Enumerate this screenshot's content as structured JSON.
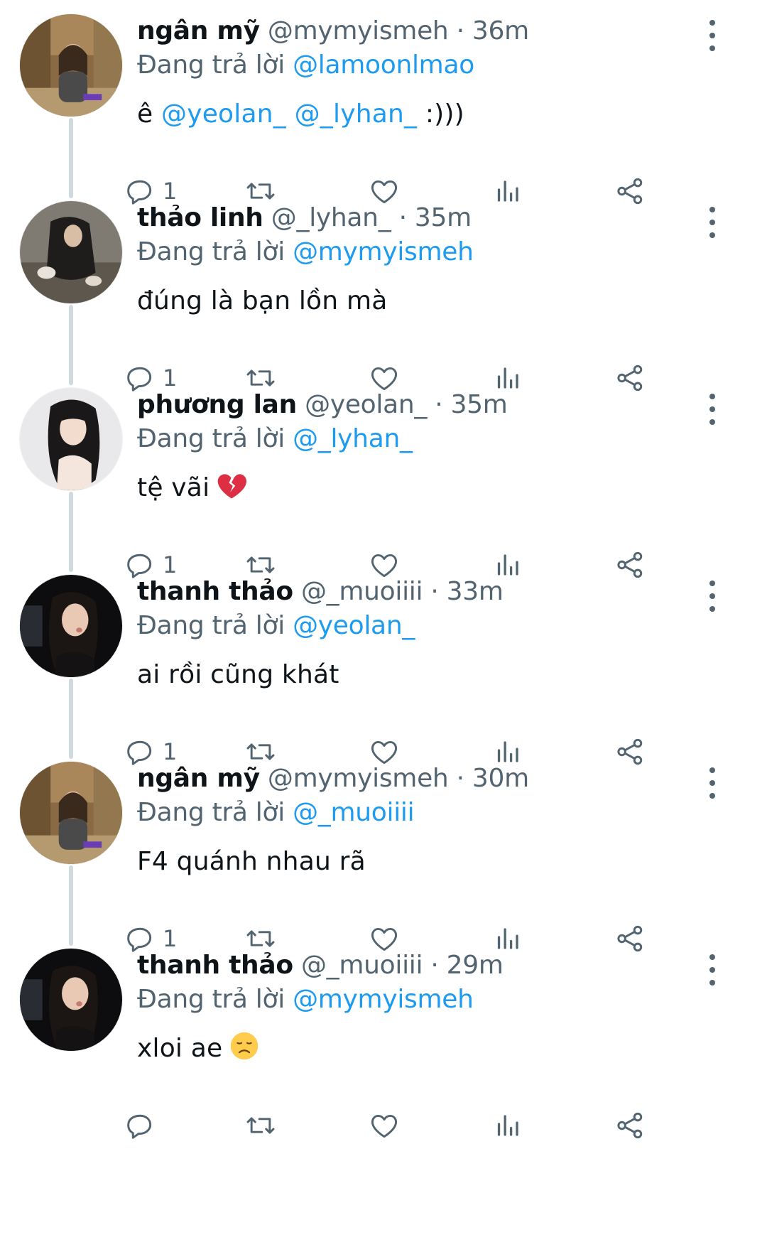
{
  "reply_prefix": "Đang trả lời",
  "separator": "·",
  "colors": {
    "accent": "#1d9bf0",
    "secondary_text": "#536471",
    "primary_text": "#0f1419",
    "thread_line": "#cfd9de"
  },
  "tweets": [
    {
      "display_name": "ngân mỹ",
      "handle": "@mymyismeh",
      "time": "36m",
      "reply_to": "@lamoonlmao",
      "text_parts": [
        "ê ",
        "@yeolan_ @_lyhan_",
        " :)))"
      ],
      "emoji": "",
      "reply_count": "1",
      "avatar": "avatar-mymyismeh"
    },
    {
      "display_name": "thảo linh",
      "handle": "@_lyhan_",
      "time": "35m",
      "reply_to": "@mymyismeh",
      "text_parts": [
        "đúng là bạn lồn mà",
        "",
        ""
      ],
      "emoji": "",
      "reply_count": "1",
      "avatar": "avatar-lyhan"
    },
    {
      "display_name": "phương lan",
      "handle": "@yeolan_",
      "time": "35m",
      "reply_to": "@_lyhan_",
      "text_parts": [
        "tệ vãi",
        "",
        ""
      ],
      "emoji": "broken-heart",
      "reply_count": "1",
      "avatar": "avatar-yeolan"
    },
    {
      "display_name": "thanh thảo",
      "handle": "@_muoiiii",
      "time": "33m",
      "reply_to": "@yeolan_",
      "text_parts": [
        "ai rồi cũng khát",
        "",
        ""
      ],
      "emoji": "",
      "reply_count": "1",
      "avatar": "avatar-muoiiii"
    },
    {
      "display_name": "ngân mỹ",
      "handle": "@mymyismeh",
      "time": "30m",
      "reply_to": "@_muoiiii",
      "text_parts": [
        "F4 quánh nhau rã",
        "",
        ""
      ],
      "emoji": "",
      "reply_count": "1",
      "avatar": "avatar-mymyismeh"
    },
    {
      "display_name": "thanh thảo",
      "handle": "@_muoiiii",
      "time": "29m",
      "reply_to": "@mymyismeh",
      "text_parts": [
        "xloi ae",
        "",
        ""
      ],
      "emoji": "disappointed-face",
      "reply_count": "",
      "avatar": "avatar-muoiiii"
    }
  ]
}
